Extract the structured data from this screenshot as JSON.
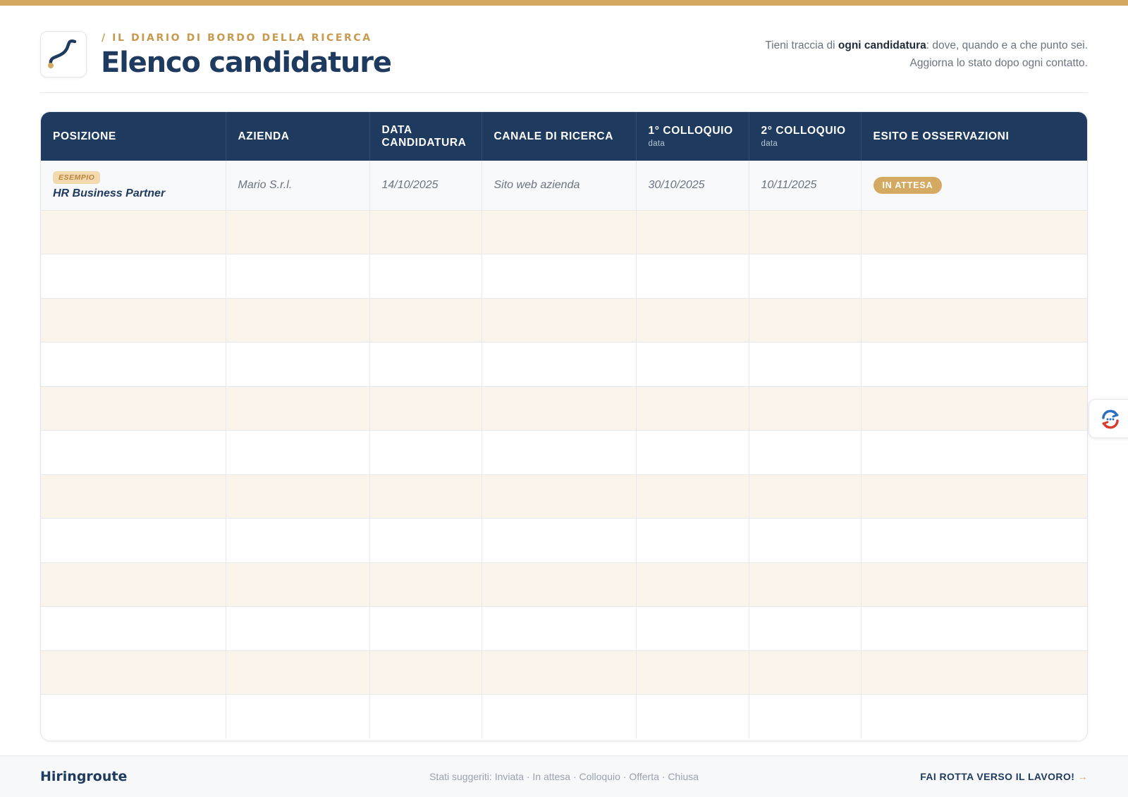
{
  "header": {
    "kicker": "/  IL DIARIO DI BORDO DELLA RICERCA",
    "title": "Elenco candidature",
    "intro_before": "Tieni traccia di ",
    "intro_bold": "ogni candidatura",
    "intro_after": ": dove, quando e a che punto sei. Aggiorna lo stato dopo ogni contatto."
  },
  "table": {
    "columns": [
      {
        "label": "POSIZIONE",
        "sub": ""
      },
      {
        "label": "AZIENDA",
        "sub": ""
      },
      {
        "label": "DATA CANDIDATURA",
        "sub": ""
      },
      {
        "label": "CANALE DI RICERCA",
        "sub": ""
      },
      {
        "label": "1° COLLOQUIO",
        "sub": "data"
      },
      {
        "label": "2° COLLOQUIO",
        "sub": "data"
      },
      {
        "label": "ESITO E OSSERVAZIONI",
        "sub": ""
      }
    ],
    "example": {
      "badge": "ESEMPIO",
      "position": "HR Business Partner",
      "company": "Mario S.r.l.",
      "application_date": "14/10/2025",
      "channel": "Sito web azienda",
      "interview_1": "30/10/2025",
      "interview_2": "10/11/2025",
      "status": "IN ATTESA"
    }
  },
  "footer": {
    "brand": "Hiringroute",
    "states": "Stati suggeriti: Inviata · In attesa · Colloquio · Offerta · Chiusa",
    "cta": "FAI ROTTA VERSO IL LAVORO!",
    "cta_arrow": "→"
  },
  "colors": {
    "navy": "#1f3a5f",
    "gold": "#d4a962",
    "cream_row": "#faf4ea"
  },
  "icons": {
    "logo": "route-path-icon",
    "side_button": "sync-arrows-icon"
  }
}
